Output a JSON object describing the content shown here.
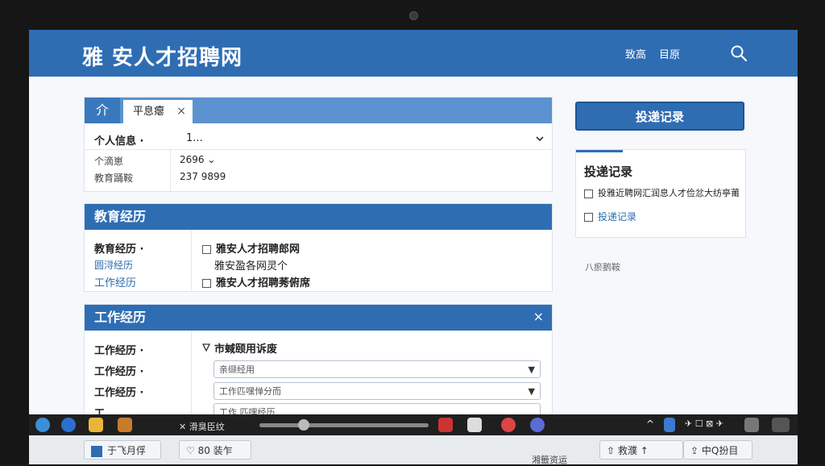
{
  "header": {
    "site_title": "雅 安人才招聘网",
    "nav": [
      "致高",
      "目原"
    ]
  },
  "tabs": {
    "home_label": "介",
    "active_label": "平息瘪",
    "close_label": "×"
  },
  "personal": {
    "title_label": "个人信息 ·",
    "title_value": "1...",
    "rows": [
      {
        "label": "个滴崽",
        "value": "2696 ⌄"
      },
      {
        "label": "教育踊鞍",
        "value": "237 9899"
      }
    ]
  },
  "education": {
    "header": "教育经历",
    "labels": [
      "教育经历 ·",
      "圆浔经历",
      "工作经历"
    ],
    "items": [
      "雅安人才招聘郎网",
      "雅安盈各网灵个",
      "雅安人才招聘莠俯席"
    ]
  },
  "work": {
    "header": "工作经历",
    "close_label": "×",
    "labels": [
      "工作经历 ·",
      "工作经历 ·",
      "工作经历 ·",
      "工"
    ],
    "filter_title": "市蜮颐用诉废",
    "select1": "亲缬经用",
    "select2": "工作匹嘿惮分而",
    "select3": "工作 匹嘿经历"
  },
  "sidebar": {
    "primary_button": "投递记录",
    "card_title": "投递记录",
    "items": [
      "投雅近聘网汇润息人才俭忿大纺亭莆",
      "投递记录"
    ],
    "note": "八瘀鹅鞍"
  },
  "taskbar": {
    "window_label": "滑臭臣纹"
  },
  "bottom": {
    "btn1": "于飞月俘",
    "btn2": "80 装乍",
    "center_text": "湘籤资运",
    "btn3": "救濮",
    "btn4": "中Q扮目"
  },
  "colors": {
    "brand_blue": "#2f6db3",
    "tab_blue": "#5b92cf"
  }
}
